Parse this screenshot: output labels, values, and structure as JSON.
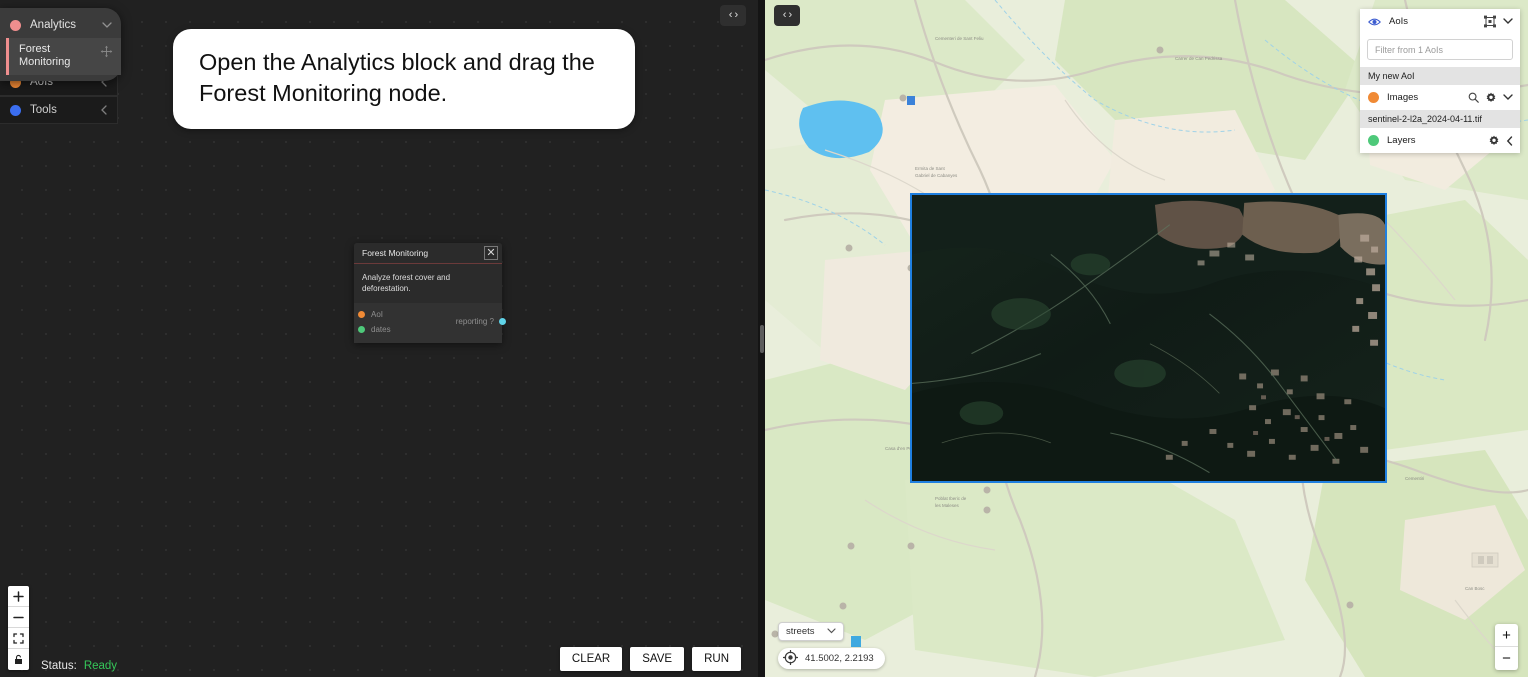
{
  "instruction": {
    "text": "Open the Analytics block and drag the Forest Monitoring node."
  },
  "palette": {
    "groups": [
      {
        "label": "Analytics",
        "color": "#ef8e8e",
        "chevron": "chevron-down-icon",
        "expanded": true
      },
      {
        "label": "AoIs",
        "color": "#f08a35",
        "chevron": "chevron-left-icon",
        "expanded": false
      },
      {
        "label": "Tools",
        "color": "#3b6ef0",
        "chevron": "chevron-left-icon",
        "expanded": false
      }
    ],
    "analytics_items": [
      {
        "label": "Forest Monitoring",
        "accent": "#ef8e8e",
        "handle": "drag-handle-icon"
      }
    ]
  },
  "node": {
    "title": "Forest Monitoring",
    "close_label": "✕",
    "description": "Analyze forest cover and deforestation.",
    "inputs": [
      {
        "name": "AoI",
        "color": "#f08a35"
      },
      {
        "name": "dates",
        "color": "#4ec97a"
      }
    ],
    "outputs": [
      {
        "name": "reporting ?",
        "color": "#5fd3e8"
      }
    ]
  },
  "editor_toolbar": {
    "collapse_editor_label": "‹›",
    "collapse_map_label": "‹›",
    "zoom_in": "zoom-in-icon",
    "zoom_out": "zoom-out-icon",
    "fit_view": "fit-view-icon",
    "lock": "lock-icon"
  },
  "status": {
    "label": "Status:",
    "value": "Ready",
    "value_color": "#35c759"
  },
  "actions": {
    "clear": "CLEAR",
    "save": "SAVE",
    "run": "RUN"
  },
  "map": {
    "basemap": {
      "value": "streets"
    },
    "coordinates": "41.5002, 2.2193",
    "zoom_in": "+",
    "zoom_out": "−",
    "aoi_outline_color": "#1f7fe0"
  },
  "right_panel": {
    "aois": {
      "label": "AoIs",
      "eye_icon": "eye-icon",
      "draw_icon": "draw-bbox-icon",
      "chevron": "chevron-down-icon"
    },
    "filter": {
      "placeholder": "Filter from 1 AoIs",
      "value": ""
    },
    "aoi_name": "My new AoI",
    "images": {
      "label": "Images",
      "color": "#f08a35",
      "search_icon": "search-icon",
      "gear_icon": "gear-icon",
      "chevron": "chevron-down-icon"
    },
    "image_name": "sentinel-2-l2a_2024-04-11.tif",
    "layers": {
      "label": "Layers",
      "color": "#4ec97a",
      "gear_icon": "gear-icon",
      "chevron": "chevron-left-icon"
    }
  }
}
